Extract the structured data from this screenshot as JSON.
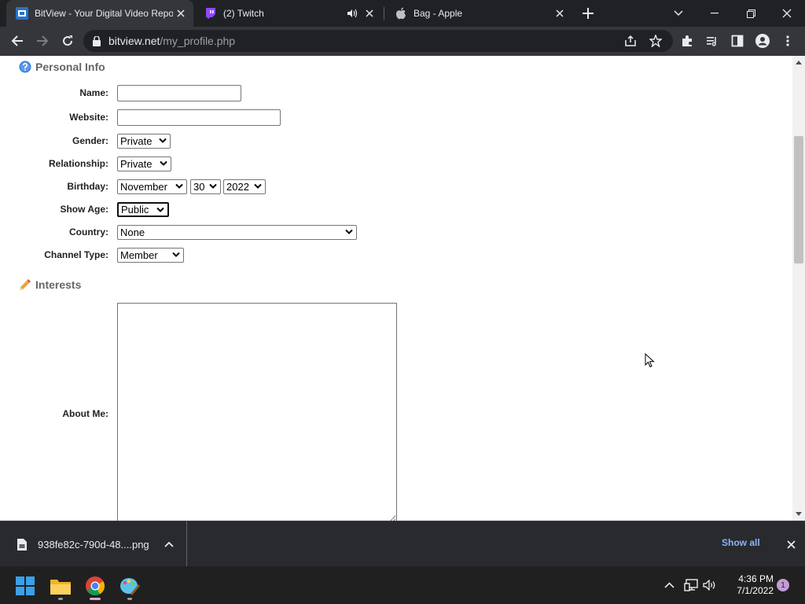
{
  "browser": {
    "tabs": [
      {
        "title": "BitView - Your Digital Video Repository",
        "favicon": "bitview-logo",
        "active": true,
        "audio": false
      },
      {
        "title": "(2) Twitch",
        "favicon": "twitch-logo",
        "active": false,
        "audio": true
      },
      {
        "title": "Bag - Apple",
        "favicon": "apple-logo",
        "active": false,
        "audio": false
      }
    ],
    "address": {
      "host": "bitview.net",
      "path": "/my_profile.php"
    }
  },
  "page": {
    "personal_info": {
      "heading": "Personal Info",
      "heading_icon": "question-circle-icon",
      "fields": {
        "name": {
          "label": "Name:",
          "value": ""
        },
        "website": {
          "label": "Website:",
          "value": ""
        },
        "gender": {
          "label": "Gender:",
          "value": "Private"
        },
        "relationship": {
          "label": "Relationship:",
          "value": "Private"
        },
        "birthday": {
          "label": "Birthday:",
          "month": "November",
          "day": "30",
          "year": "2022"
        },
        "show_age": {
          "label": "Show Age:",
          "value": "Public"
        },
        "country": {
          "label": "Country:",
          "value": "None"
        },
        "channel_type": {
          "label": "Channel Type:",
          "value": "Member"
        }
      }
    },
    "interests": {
      "heading": "Interests",
      "heading_icon": "pencil-icon",
      "about_me": {
        "label": "About Me:",
        "value": ""
      }
    }
  },
  "downloads": {
    "file_name": "938fe82c-790d-48....png",
    "show_all": "Show all"
  },
  "taskbar": {
    "apps": [
      "start-icon",
      "file-explorer-icon",
      "chrome-icon",
      "paint-icon"
    ],
    "time": "4:36 PM",
    "date": "7/1/2022",
    "notifications": "1"
  },
  "colors": {
    "tab_strip": "#202124",
    "toolbar": "#35363a",
    "link_blue": "#8ab4f8",
    "heading_grey": "#666666"
  }
}
